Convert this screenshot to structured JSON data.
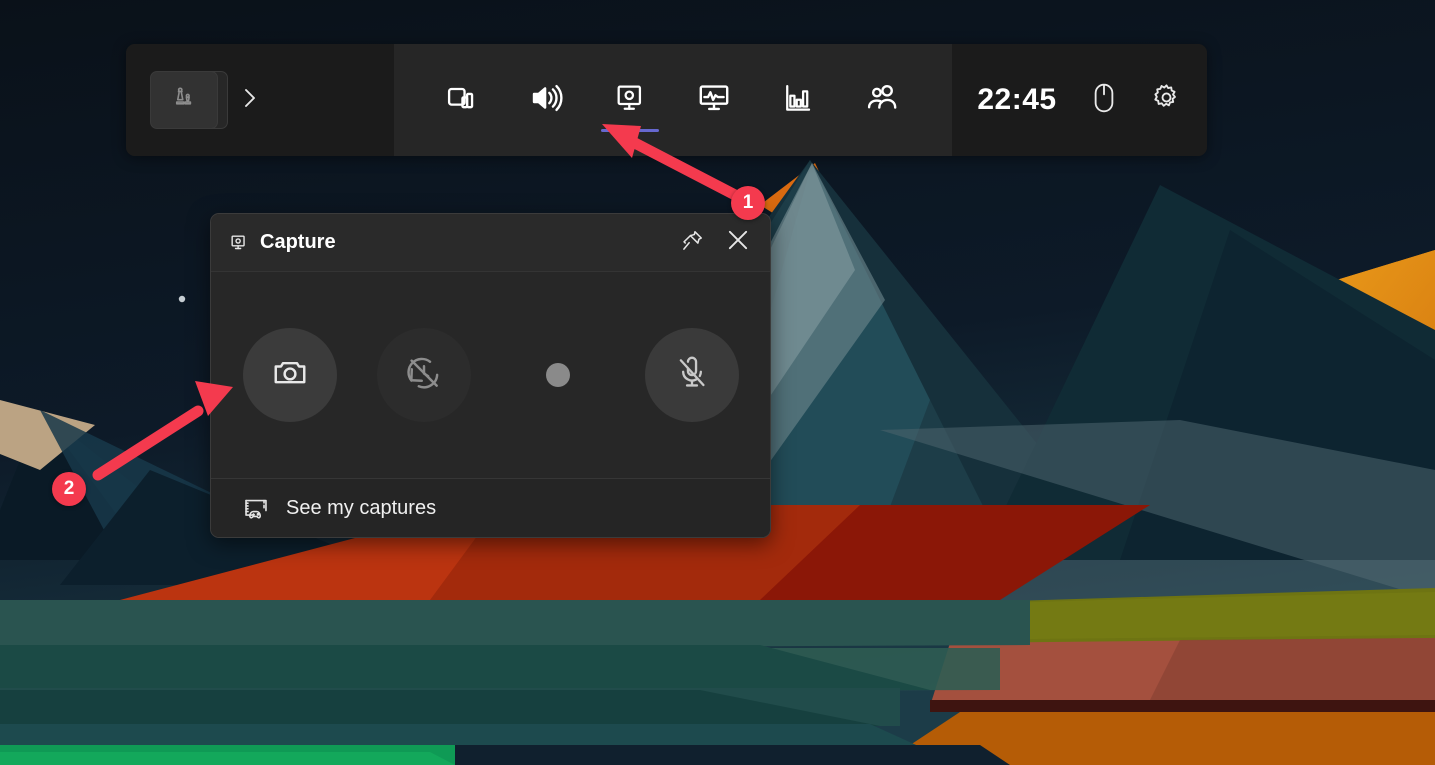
{
  "wallpaper": {
    "name": "abstract-polygonal-mountains",
    "sky": "#0c1523",
    "colors": {
      "sky_top": "#0b1320",
      "sky_bottom": "#16303d",
      "mountain_dark": "#0f2630",
      "mountain_teal": "#24454f",
      "mountain_slate": "#536a72",
      "mountain_light": "#7e9399",
      "orange_bright": "#e8971a",
      "orange_deep": "#c8650f",
      "red_bright": "#c0350f",
      "red_dark": "#8b1707",
      "green_bright": "#0f9a55",
      "green_deep": "#1d5a4a",
      "olive": "#6e7412",
      "brick": "#a4503e",
      "tan": "#bba383"
    }
  },
  "gamebar": {
    "name": "Xbox Game Bar",
    "left": {
      "widget_tile_icon": "chess-pieces-icon",
      "expand_icon": "chevron-right-icon"
    },
    "tabs": [
      {
        "id": "widgets",
        "icon": "widget-store-icon",
        "label": "Widget store",
        "active": false
      },
      {
        "id": "audio",
        "icon": "speaker-icon",
        "label": "Audio",
        "active": false
      },
      {
        "id": "capture",
        "icon": "capture-icon",
        "label": "Capture",
        "active": true
      },
      {
        "id": "performance",
        "icon": "performance-icon",
        "label": "Performance",
        "active": false
      },
      {
        "id": "resources",
        "icon": "bar-chart-icon",
        "label": "Resources",
        "active": false
      },
      {
        "id": "xbox-social",
        "icon": "people-icon",
        "label": "Xbox Social",
        "active": false
      }
    ],
    "right": {
      "clock": "22:45",
      "mouse_icon": "mouse-icon",
      "settings_icon": "gear-icon"
    },
    "accent_color": "#6668cf"
  },
  "capture_panel": {
    "title": "Capture",
    "title_icon": "capture-icon",
    "pin_icon": "pin-icon",
    "close_icon": "close-icon",
    "buttons": [
      {
        "id": "screenshot",
        "icon": "camera-icon",
        "label": "Take screenshot",
        "state": "hover"
      },
      {
        "id": "record-last-30",
        "icon": "clock-slash-icon",
        "label": "Record last 30 seconds",
        "state": "disabled"
      },
      {
        "id": "start-recording",
        "icon": "record-dot-icon",
        "label": "Start recording",
        "state": "normal"
      },
      {
        "id": "toggle-mic",
        "icon": "microphone-muted-icon",
        "label": "Turn on mic while recording",
        "state": "muted"
      }
    ],
    "footer": {
      "link_label": "See my captures",
      "link_icon": "gallery-gamepad-icon"
    }
  },
  "annotations": {
    "accent_color": "#f43a4e",
    "steps": [
      {
        "number": "1",
        "points_to": "capture-tab"
      },
      {
        "number": "2",
        "points_to": "screenshot-button"
      }
    ]
  }
}
